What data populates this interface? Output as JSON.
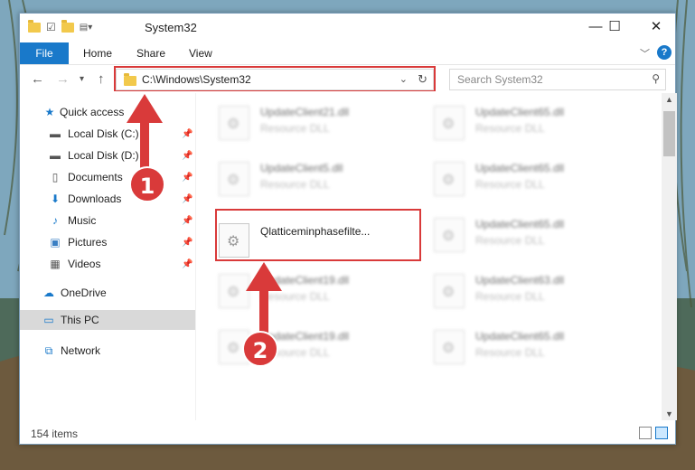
{
  "window": {
    "title": "System32",
    "minimize": "—",
    "maximize": "☐",
    "close": "✕"
  },
  "ribbon": {
    "tabs": [
      "File",
      "Home",
      "Share",
      "View"
    ]
  },
  "address": {
    "path": "C:\\Windows\\System32",
    "search_placeholder": "Search System32"
  },
  "nav": {
    "quick_access": "Quick access",
    "items": [
      {
        "label": "Local Disk (C:)",
        "icon": "drive-icon"
      },
      {
        "label": "Local Disk (D:)",
        "icon": "drive-icon"
      },
      {
        "label": "Documents",
        "icon": "documents-icon"
      },
      {
        "label": "Downloads",
        "icon": "downloads-icon"
      },
      {
        "label": "Music",
        "icon": "music-icon"
      },
      {
        "label": "Pictures",
        "icon": "pictures-icon"
      },
      {
        "label": "Videos",
        "icon": "videos-icon"
      }
    ],
    "onedrive": "OneDrive",
    "this_pc": "This PC",
    "network": "Network"
  },
  "files": [
    {
      "name": "UpdateClient21.dll",
      "type": "Resource DLL"
    },
    {
      "name": "UpdateClient65.dll",
      "type": "Resource DLL"
    },
    {
      "name": "UpdateClient5.dll",
      "type": "Resource DLL"
    },
    {
      "name": "UpdateClient65.dll",
      "type": "Resource DLL"
    },
    {
      "name": "Qlatticeminphasefilte...",
      "type": ""
    },
    {
      "name": "UpdateClient65.dll",
      "type": "Resource DLL"
    },
    {
      "name": "UpdateClient19.dll",
      "type": "Resource DLL"
    },
    {
      "name": "UpdateClient63.dll",
      "type": "Resource DLL"
    },
    {
      "name": "UpdateClient19.dll",
      "type": "Resource DLL"
    },
    {
      "name": "UpdateClient65.dll",
      "type": "Resource DLL"
    }
  ],
  "status": {
    "item_count": "154 items"
  },
  "callouts": [
    "1",
    "2"
  ],
  "colors": {
    "accent": "#1979ca",
    "highlight": "#d93a3a"
  }
}
